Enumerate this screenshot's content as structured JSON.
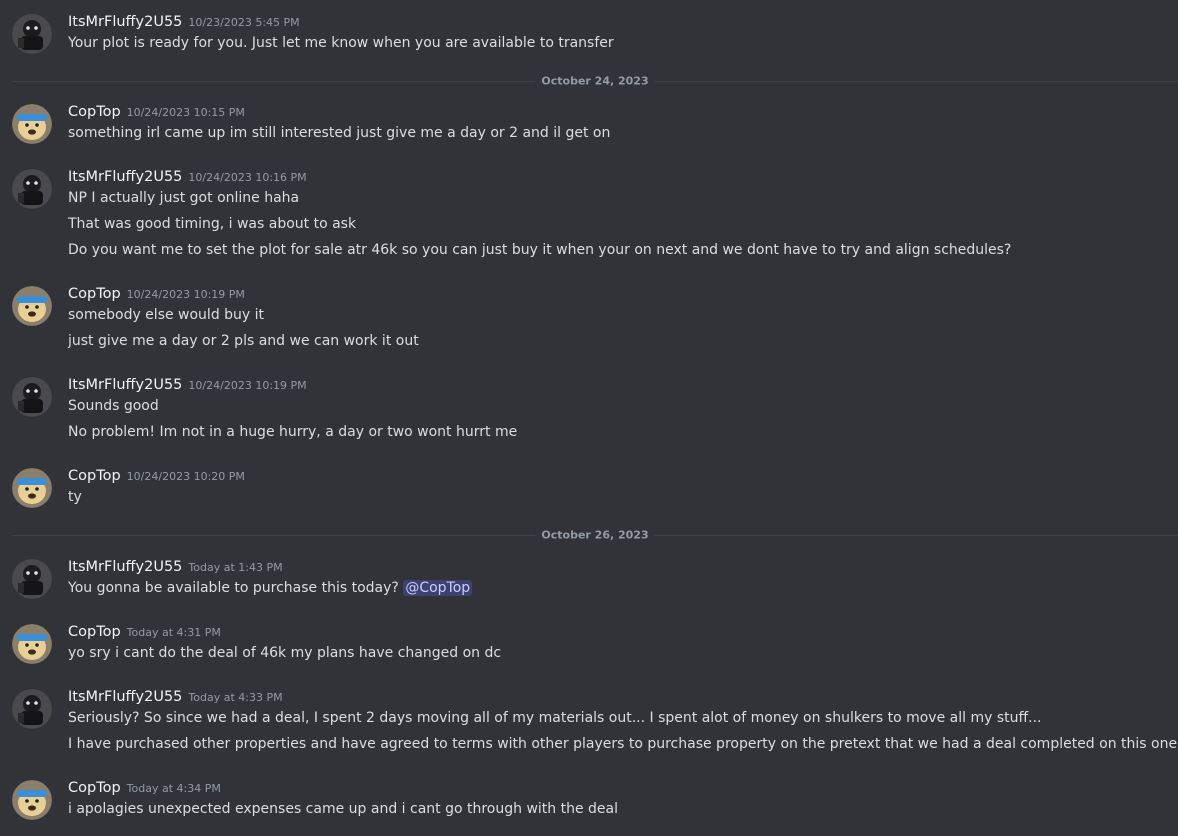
{
  "users": {
    "fluffy": {
      "name": "ItsMrFluffy2U55",
      "avatar_icon": "dark-character-avatar-icon"
    },
    "coptop": {
      "name": "CopTop",
      "avatar_icon": "dog-with-blue-headband-avatar-icon"
    }
  },
  "colors": {
    "background": "#313338",
    "divider": "#3f4147",
    "mention_bg": "#3c4270",
    "mention_text": "#c9cdfb"
  },
  "dividers": [
    {
      "label": "October 24, 2023"
    },
    {
      "label": "October 26, 2023"
    }
  ],
  "messages": [
    {
      "author": "ItsMrFluffy2U55",
      "timestamp": "10/23/2023 5:45 PM",
      "lines": [
        "Your plot is ready for you. Just let me know when you are available to transfer"
      ]
    },
    {
      "author": "CopTop",
      "timestamp": "10/24/2023 10:15 PM",
      "lines": [
        "something irl came up im still interested just give me a day or 2 and il get on"
      ]
    },
    {
      "author": "ItsMrFluffy2U55",
      "timestamp": "10/24/2023 10:16 PM",
      "lines": [
        "NP I actually just got online haha",
        "That was good timing, i was about to ask",
        "Do you want me to set the plot for sale atr 46k so you can just buy it when your on next and we dont have to try and align schedules?"
      ]
    },
    {
      "author": "CopTop",
      "timestamp": "10/24/2023 10:19 PM",
      "lines": [
        "somebody else would buy it",
        "just give me a day or 2 pls and we can work it out"
      ]
    },
    {
      "author": "ItsMrFluffy2U55",
      "timestamp": "10/24/2023 10:19 PM",
      "lines": [
        "Sounds good",
        "No problem! Im not in a huge hurry, a day or two wont hurrt me"
      ]
    },
    {
      "author": "CopTop",
      "timestamp": "10/24/2023 10:20 PM",
      "lines": [
        "ty"
      ]
    },
    {
      "author": "ItsMrFluffy2U55",
      "timestamp": "Today at 1:43 PM",
      "lines": [
        "You gonna be available to purchase this today? "
      ],
      "mention": "@CopTop"
    },
    {
      "author": "CopTop",
      "timestamp": "Today at 4:31 PM",
      "lines": [
        "yo sry i cant do the deal of 46k my plans have changed on dc"
      ]
    },
    {
      "author": "ItsMrFluffy2U55",
      "timestamp": "Today at 4:33 PM",
      "lines": [
        "Seriously? So since we had a deal, I spent 2 days moving all of my materials out... I spent alot of money on shulkers to move all my stuff...",
        "I have purchased other properties and have agreed to terms with other players to purchase property on the pretext that we had a deal completed on this one."
      ]
    },
    {
      "author": "CopTop",
      "timestamp": "Today at 4:34 PM",
      "lines": [
        "i apolagies unexpected expenses came up and i cant go through with the deal"
      ]
    }
  ]
}
